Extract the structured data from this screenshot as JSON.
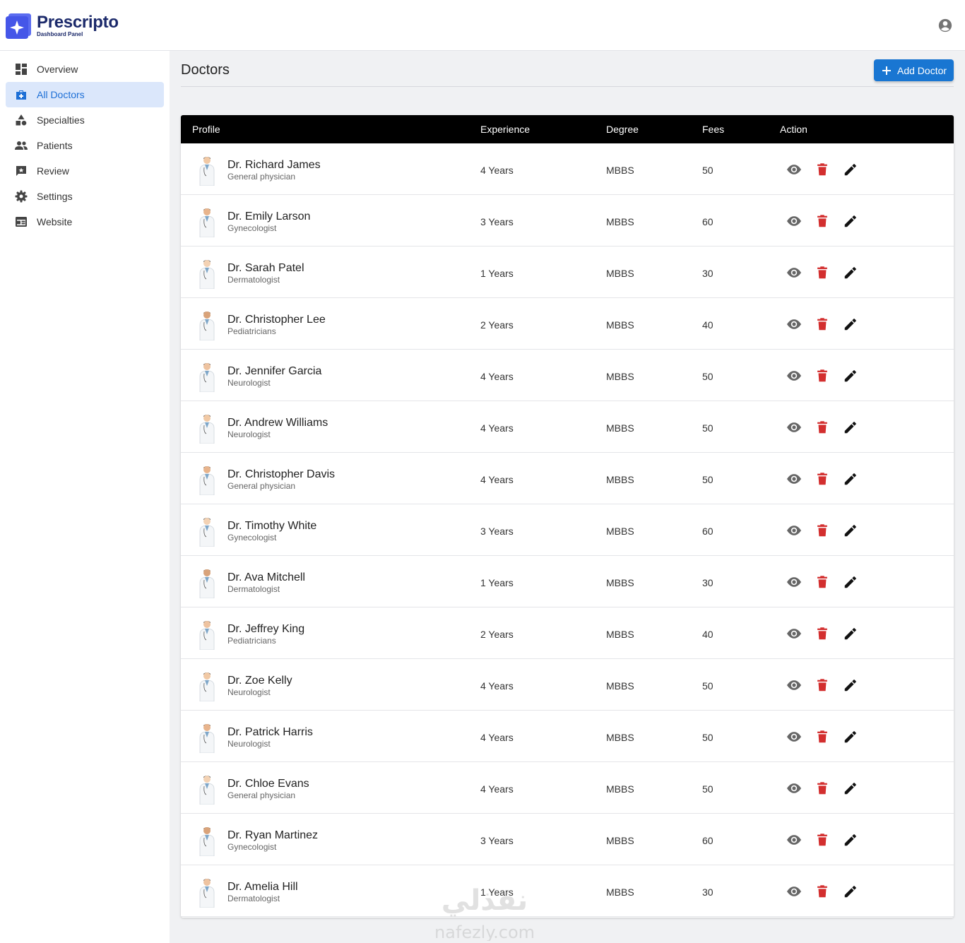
{
  "app": {
    "name": "Prescripto",
    "subtitle": "Dashboard Panel",
    "brand_color": "#1c2a6b",
    "accent_color": "#1976d2"
  },
  "header": {
    "account_icon": "account-circle-icon"
  },
  "sidebar": {
    "items": [
      {
        "label": "Overview",
        "icon": "dashboard-icon",
        "active": false
      },
      {
        "label": "All Doctors",
        "icon": "medical-bag-icon",
        "active": true
      },
      {
        "label": "Specialties",
        "icon": "category-icon",
        "active": false
      },
      {
        "label": "Patients",
        "icon": "people-icon",
        "active": false
      },
      {
        "label": "Review",
        "icon": "review-icon",
        "active": false
      },
      {
        "label": "Settings",
        "icon": "gear-icon",
        "active": false
      },
      {
        "label": "Website",
        "icon": "web-icon",
        "active": false
      }
    ]
  },
  "main": {
    "title": "Doctors",
    "add_button": "Add Doctor"
  },
  "table": {
    "columns": [
      "Profile",
      "Experience",
      "Degree",
      "Fees",
      "Action"
    ],
    "rows": [
      {
        "name": "Dr. Richard James",
        "specialty": "General physician",
        "experience": "4 Years",
        "degree": "MBBS",
        "fees": "50"
      },
      {
        "name": "Dr. Emily Larson",
        "specialty": "Gynecologist",
        "experience": "3 Years",
        "degree": "MBBS",
        "fees": "60"
      },
      {
        "name": "Dr. Sarah Patel",
        "specialty": "Dermatologist",
        "experience": "1 Years",
        "degree": "MBBS",
        "fees": "30"
      },
      {
        "name": "Dr. Christopher Lee",
        "specialty": "Pediatricians",
        "experience": "2 Years",
        "degree": "MBBS",
        "fees": "40"
      },
      {
        "name": "Dr. Jennifer Garcia",
        "specialty": "Neurologist",
        "experience": "4 Years",
        "degree": "MBBS",
        "fees": "50"
      },
      {
        "name": "Dr. Andrew Williams",
        "specialty": "Neurologist",
        "experience": "4 Years",
        "degree": "MBBS",
        "fees": "50"
      },
      {
        "name": "Dr. Christopher Davis",
        "specialty": "General physician",
        "experience": "4 Years",
        "degree": "MBBS",
        "fees": "50"
      },
      {
        "name": "Dr. Timothy White",
        "specialty": "Gynecologist",
        "experience": "3 Years",
        "degree": "MBBS",
        "fees": "60"
      },
      {
        "name": "Dr. Ava Mitchell",
        "specialty": "Dermatologist",
        "experience": "1 Years",
        "degree": "MBBS",
        "fees": "30"
      },
      {
        "name": "Dr. Jeffrey King",
        "specialty": "Pediatricians",
        "experience": "2 Years",
        "degree": "MBBS",
        "fees": "40"
      },
      {
        "name": "Dr. Zoe Kelly",
        "specialty": "Neurologist",
        "experience": "4 Years",
        "degree": "MBBS",
        "fees": "50"
      },
      {
        "name": "Dr. Patrick Harris",
        "specialty": "Neurologist",
        "experience": "4 Years",
        "degree": "MBBS",
        "fees": "50"
      },
      {
        "name": "Dr. Chloe Evans",
        "specialty": "General physician",
        "experience": "4 Years",
        "degree": "MBBS",
        "fees": "50"
      },
      {
        "name": "Dr. Ryan Martinez",
        "specialty": "Gynecologist",
        "experience": "3 Years",
        "degree": "MBBS",
        "fees": "60"
      },
      {
        "name": "Dr. Amelia Hill",
        "specialty": "Dermatologist",
        "experience": "1 Years",
        "degree": "MBBS",
        "fees": "30"
      }
    ],
    "action_icons": [
      "eye-icon",
      "trash-icon",
      "pencil-icon"
    ],
    "delete_color": "#d32f2f"
  },
  "watermark": {
    "text": "نفذلي",
    "domain": "nafezly.com"
  }
}
